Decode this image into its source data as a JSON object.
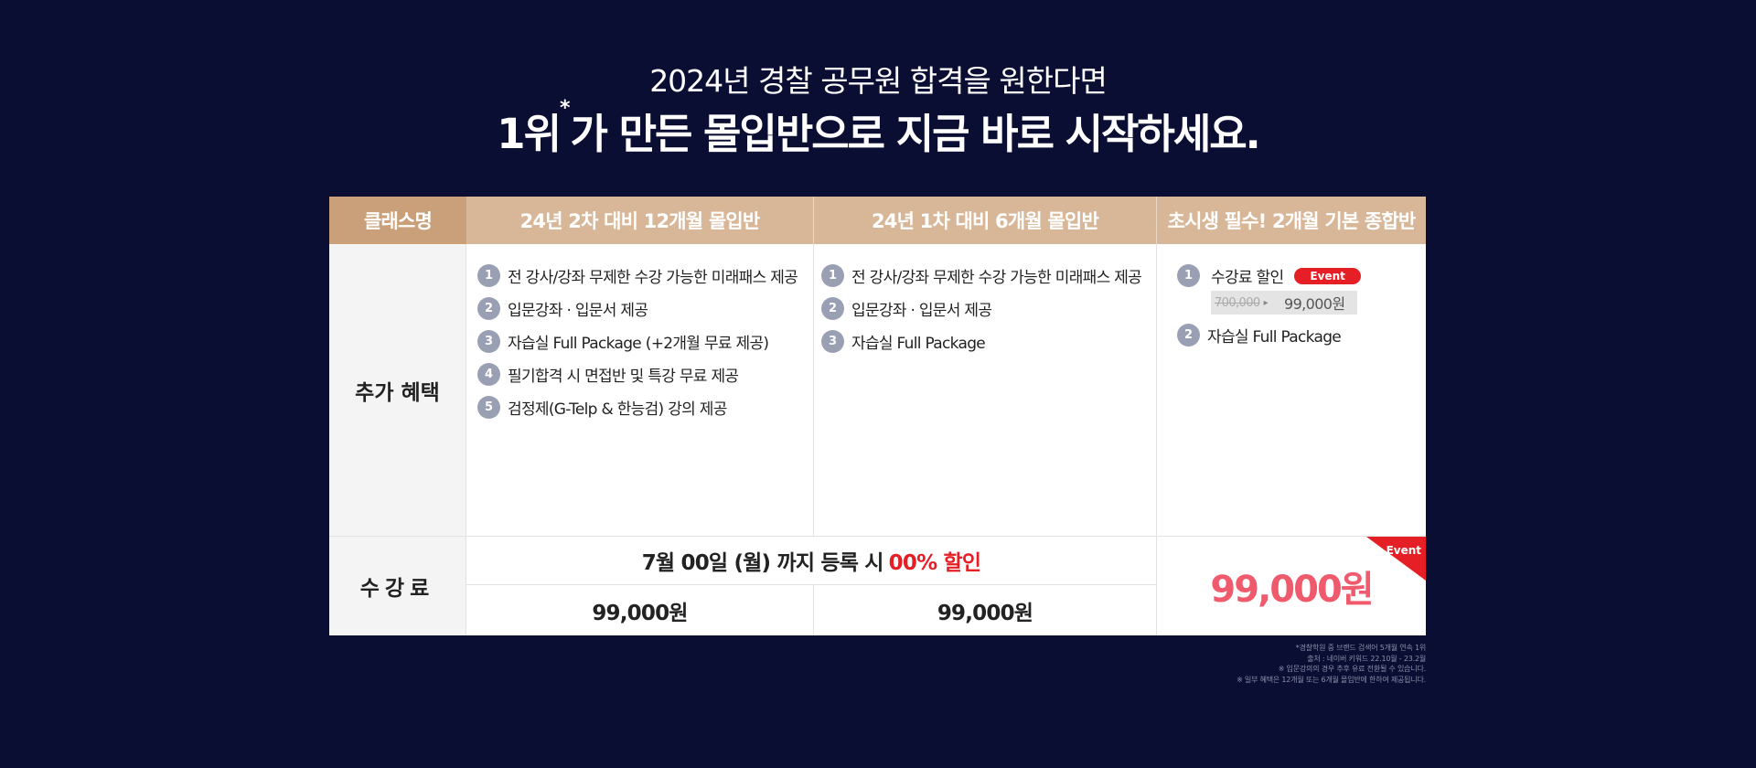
{
  "headline": {
    "line1": "2024년 경찰 공무원 합격을 원한다면",
    "line2_rank": "1위",
    "line2_mark": "*",
    "line2_rest": "가 만든 몰입반으로 지금 바로 시작하세요."
  },
  "table": {
    "header_label": "클래스명",
    "columns": [
      "24년 2차 대비 12개월 몰입반",
      "24년 1차 대비 6개월 몰입반",
      "초시생 필수! 2개월 기본 종합반"
    ],
    "benefit_label": "추가 혜택",
    "benefits_col1": [
      {
        "num": "1",
        "text": "전 강사/강좌 무제한 수강 가능한 미래패스 제공"
      },
      {
        "num": "2",
        "text": "입문강좌 · 입문서 제공"
      },
      {
        "num": "3",
        "text": "자습실 Full Package (+2개월 무료 제공)"
      },
      {
        "num": "4",
        "text": "필기합격 시 면접반 및 특강 무료 제공"
      },
      {
        "num": "5",
        "text": "검정제(G-Telp & 한능검) 강의 제공"
      }
    ],
    "benefits_col2": [
      {
        "num": "1",
        "text": "전 강사/강좌 무제한 수강 가능한 미래패스 제공"
      },
      {
        "num": "2",
        "text": "입문강좌 · 입문서 제공"
      },
      {
        "num": "3",
        "text": "자습실 Full Package"
      }
    ],
    "benefits_col3": {
      "discount_num": "1",
      "discount_text": "수강료 할인",
      "event_badge": "Event",
      "old_price": "700,000",
      "new_price": "99,000원",
      "item2_num": "2",
      "item2_text": "자습실 Full Package"
    },
    "fee_label": "수강료",
    "promo_text": "7월 00일 (월) 까지 등록 시",
    "promo_highlight": "00% 할인",
    "fee_col1": "99,000원",
    "fee_col2": "99,000원",
    "fee_col3": "99,000원",
    "corner_badge": "Event"
  },
  "footnotes": [
    "*경찰학원 중 브랜드 검색어 5개월 연속 1위",
    "출처 : 네이버 키워드 22.10월 - 23.2월",
    "※ 입문강의의 경우 추후 유료 전환될 수 있습니다.",
    "※ 일부 혜택은 12개월 또는 6개월 몰입반에 한하여 제공됩니다."
  ],
  "colors": {
    "background": "#0b0e33",
    "header_primary": "#c9a07a",
    "header_secondary": "#d8b799",
    "accent_red": "#e61e25",
    "price_pink": "#ef5a6d",
    "number_badge": "#9aa0b4"
  }
}
